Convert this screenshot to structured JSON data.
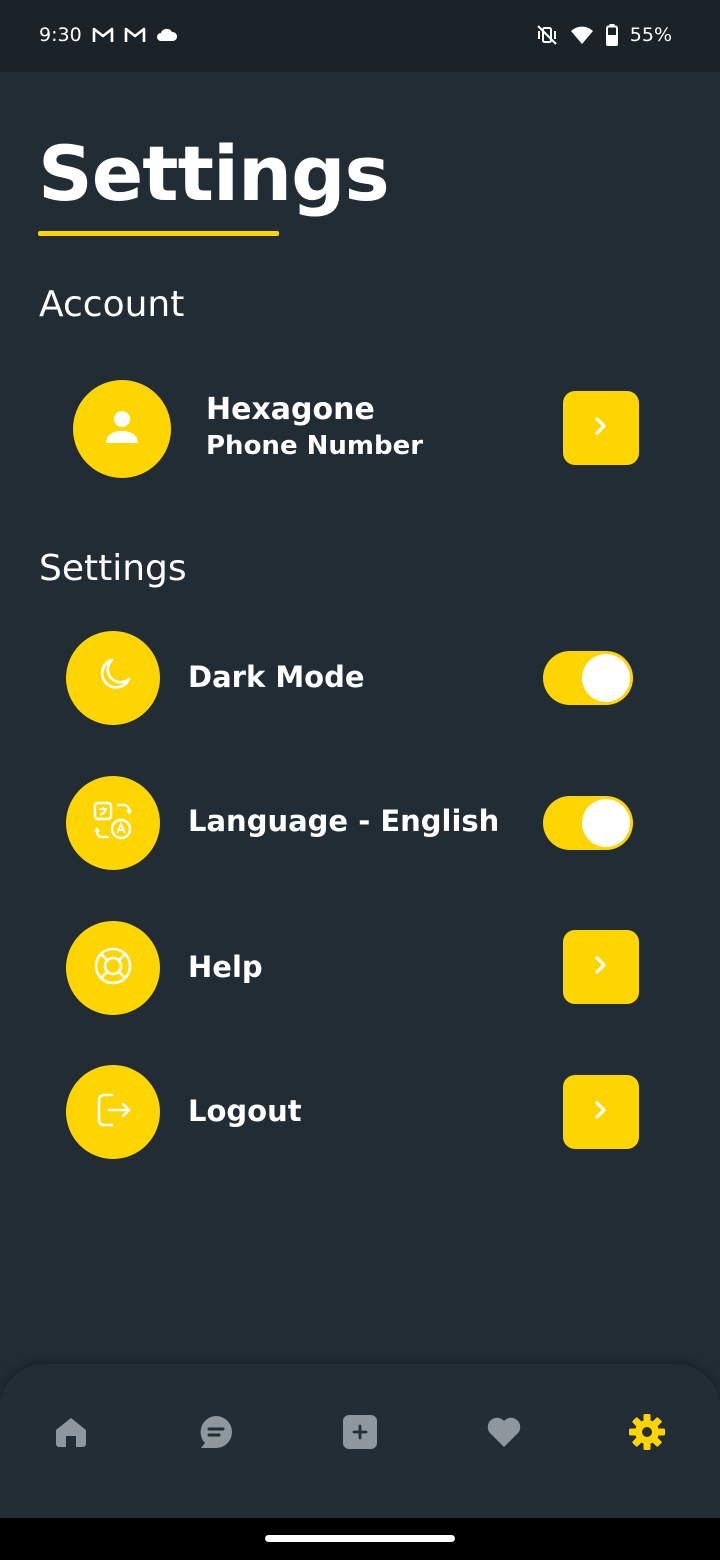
{
  "status_bar": {
    "time": "9:30",
    "battery": "55%",
    "icons": [
      "gmail-icon",
      "gmail-icon",
      "cloud-icon",
      "vibrate-off-icon",
      "wifi-icon",
      "battery-icon"
    ]
  },
  "page": {
    "title": "Settings"
  },
  "account": {
    "heading": "Account",
    "name": "Hexagone",
    "phone": "Phone Number",
    "icon": "user-icon"
  },
  "settings": {
    "heading": "Settings",
    "items": [
      {
        "label": "Dark Mode",
        "icon": "moon-icon",
        "control": "toggle",
        "on": true
      },
      {
        "label": "Language - English",
        "icon": "translate-icon",
        "control": "toggle",
        "on": true
      },
      {
        "label": "Help",
        "icon": "lifebuoy-icon",
        "control": "arrow"
      },
      {
        "label": "Logout",
        "icon": "logout-icon",
        "control": "arrow"
      }
    ]
  },
  "bottom_nav": {
    "items": [
      {
        "icon": "home-icon",
        "active": false
      },
      {
        "icon": "chat-icon",
        "active": false
      },
      {
        "icon": "add-icon",
        "active": false
      },
      {
        "icon": "heart-icon",
        "active": false
      },
      {
        "icon": "gear-icon",
        "active": true
      }
    ]
  },
  "colors": {
    "accent": "#ffd500",
    "background": "#212c35",
    "inactive_icon": "#8e979d"
  }
}
